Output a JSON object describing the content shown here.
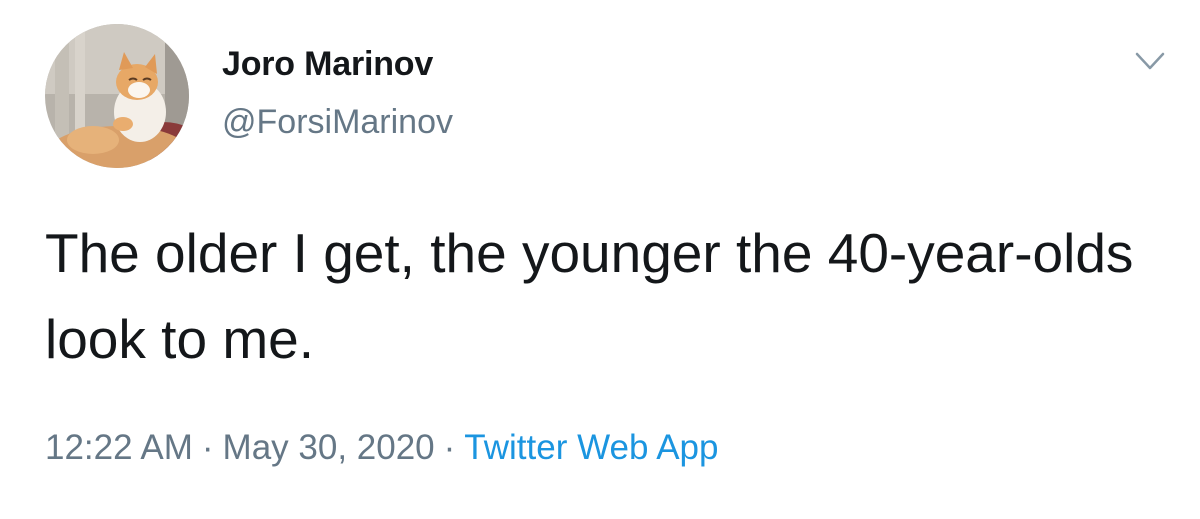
{
  "tweet": {
    "author": {
      "name": "Joro Marinov",
      "handle": "@ForsiMarinov",
      "avatar_icon": "cat-avatar-icon"
    },
    "more_icon": "chevron-down-icon",
    "text": "The older I get, the younger the 40-year-olds look to me.",
    "time": "12:22 AM",
    "date": "May 30, 2020",
    "separator": "·",
    "source": "Twitter Web App"
  },
  "colors": {
    "text": "#14171a",
    "secondary": "#657786",
    "link": "#1b95e0",
    "background": "#ffffff"
  }
}
